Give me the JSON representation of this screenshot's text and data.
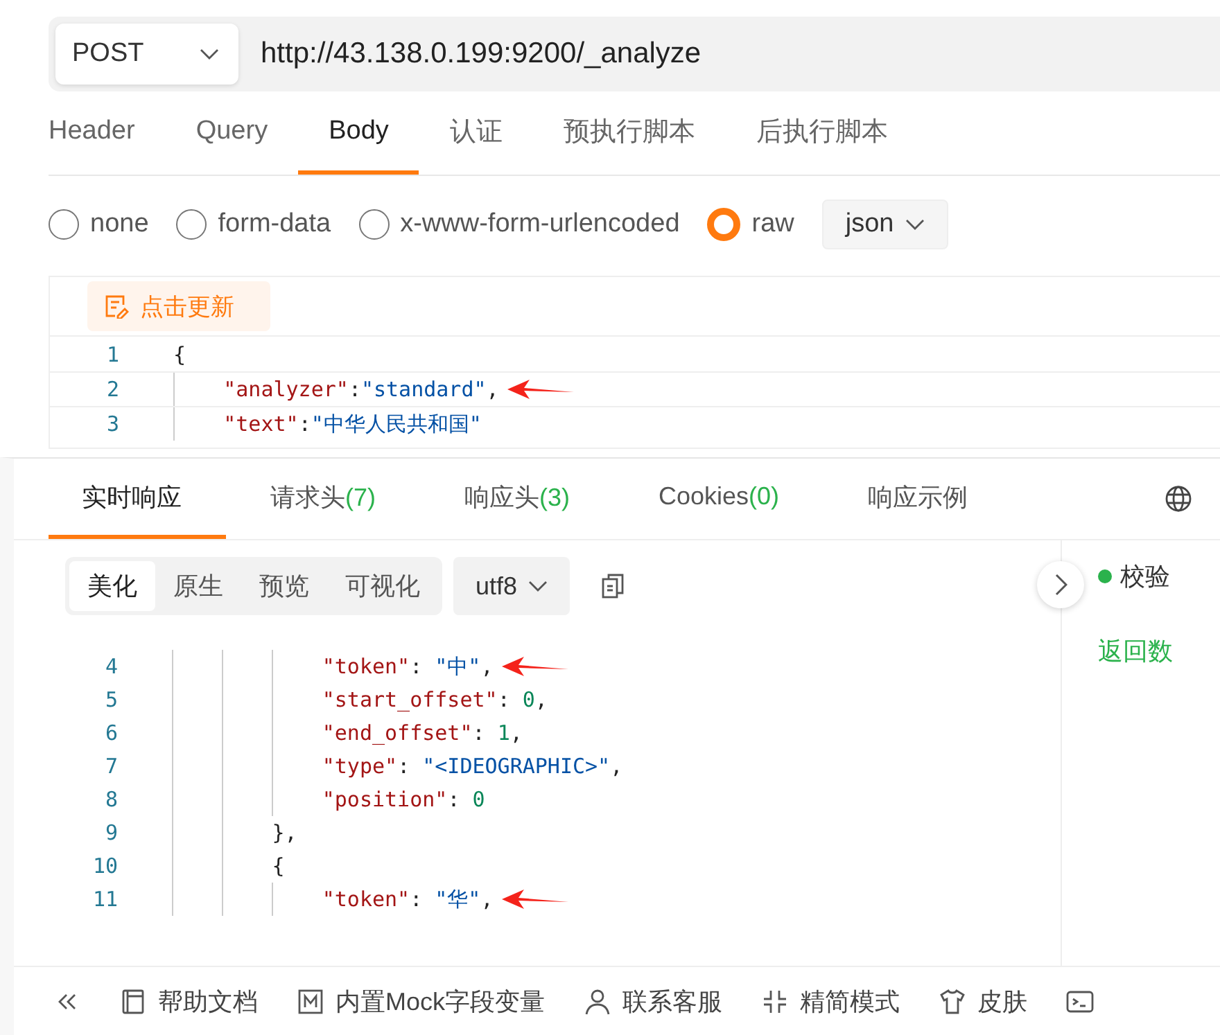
{
  "request": {
    "method": "POST",
    "url": "http://43.138.0.199:9200/_analyze"
  },
  "request_tabs": [
    {
      "label": "Header",
      "selected": false
    },
    {
      "label": "Query",
      "selected": false
    },
    {
      "label": "Body",
      "selected": true
    },
    {
      "label": "认证",
      "selected": false
    },
    {
      "label": "预执行脚本",
      "selected": false
    },
    {
      "label": "后执行脚本",
      "selected": false
    }
  ],
  "body_types": [
    {
      "label": "none",
      "selected": false
    },
    {
      "label": "form-data",
      "selected": false
    },
    {
      "label": "x-www-form-urlencoded",
      "selected": false
    },
    {
      "label": "raw",
      "selected": true
    }
  ],
  "format": "json",
  "update_button": "点击更新",
  "request_code": [
    {
      "number": "1",
      "arrow": false,
      "tokens": [
        {
          "kind": "punct",
          "text": "{"
        }
      ]
    },
    {
      "number": "2",
      "arrow": true,
      "tokens": [
        {
          "kind": "key",
          "text": "    \"analyzer\""
        },
        {
          "kind": "punct",
          "text": ":"
        },
        {
          "kind": "str",
          "text": "\"standard\""
        },
        {
          "kind": "punct",
          "text": ","
        }
      ]
    },
    {
      "number": "3",
      "arrow": false,
      "tokens": [
        {
          "kind": "key",
          "text": "    \"text\""
        },
        {
          "kind": "punct",
          "text": ":"
        },
        {
          "kind": "str",
          "text": "\"中华人民共和国\""
        }
      ]
    }
  ],
  "response_tabs": [
    {
      "label": "实时响应",
      "selected": true
    },
    {
      "label": "请求头",
      "count": "(7)",
      "selected": false
    },
    {
      "label": "响应头",
      "count": "(3)",
      "selected": false
    },
    {
      "label": "Cookies",
      "count": "(0)",
      "selected": false
    },
    {
      "label": "响应示例",
      "selected": false
    }
  ],
  "view_modes": [
    {
      "label": "美化",
      "selected": true
    },
    {
      "label": "原生",
      "selected": false
    },
    {
      "label": "预览",
      "selected": false
    },
    {
      "label": "可视化",
      "selected": false
    }
  ],
  "encoding": "utf8",
  "side_panel": {
    "status": "校验",
    "link": "返回数"
  },
  "response_code": [
    {
      "number": "4",
      "arrow": true,
      "tokens": [
        {
          "kind": "key",
          "text": "            \"token\""
        },
        {
          "kind": "punct",
          "text": ": "
        },
        {
          "kind": "str",
          "text": "\"中\""
        },
        {
          "kind": "punct",
          "text": ","
        }
      ]
    },
    {
      "number": "5",
      "arrow": false,
      "tokens": [
        {
          "kind": "key",
          "text": "            \"start_offset\""
        },
        {
          "kind": "punct",
          "text": ": "
        },
        {
          "kind": "num",
          "text": "0"
        },
        {
          "kind": "punct",
          "text": ","
        }
      ]
    },
    {
      "number": "6",
      "arrow": false,
      "tokens": [
        {
          "kind": "key",
          "text": "            \"end_offset\""
        },
        {
          "kind": "punct",
          "text": ": "
        },
        {
          "kind": "num",
          "text": "1"
        },
        {
          "kind": "punct",
          "text": ","
        }
      ]
    },
    {
      "number": "7",
      "arrow": false,
      "tokens": [
        {
          "kind": "key",
          "text": "            \"type\""
        },
        {
          "kind": "punct",
          "text": ": "
        },
        {
          "kind": "str",
          "text": "\"<IDEOGRAPHIC>\""
        },
        {
          "kind": "punct",
          "text": ","
        }
      ]
    },
    {
      "number": "8",
      "arrow": false,
      "tokens": [
        {
          "kind": "key",
          "text": "            \"position\""
        },
        {
          "kind": "punct",
          "text": ": "
        },
        {
          "kind": "num",
          "text": "0"
        }
      ]
    },
    {
      "number": "9",
      "arrow": false,
      "tokens": [
        {
          "kind": "punct",
          "text": "        },"
        }
      ]
    },
    {
      "number": "10",
      "arrow": false,
      "tokens": [
        {
          "kind": "punct",
          "text": "        {"
        }
      ]
    },
    {
      "number": "11",
      "arrow": true,
      "tokens": [
        {
          "kind": "key",
          "text": "            \"token\""
        },
        {
          "kind": "punct",
          "text": ": "
        },
        {
          "kind": "str",
          "text": "\"华\""
        },
        {
          "kind": "punct",
          "text": ","
        }
      ]
    }
  ],
  "footer": [
    "帮助文档",
    "内置Mock字段变量",
    "联系客服",
    "精简模式",
    "皮肤"
  ]
}
